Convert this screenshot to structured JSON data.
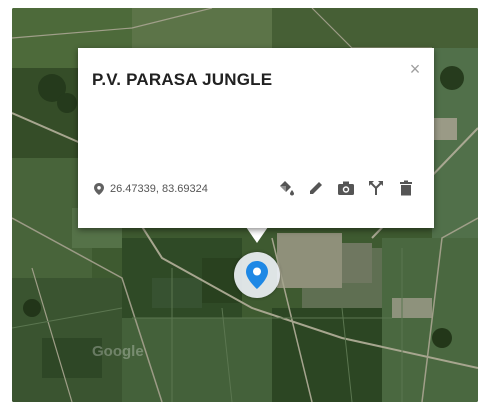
{
  "place": {
    "title": "P.V. PARASA JUNGLE",
    "coordinates": "26.47339, 83.69324"
  },
  "popup": {
    "close_glyph": "×"
  },
  "toolbar": {
    "icons": [
      "style-bucket-icon",
      "edit-pencil-icon",
      "camera-icon",
      "directions-icon",
      "trash-icon"
    ]
  },
  "map": {
    "watermark": "Google"
  },
  "colors": {
    "marker_blue": "#1e88e5",
    "toolbar_gray": "#555555",
    "field_green": "#3f5a2f"
  }
}
